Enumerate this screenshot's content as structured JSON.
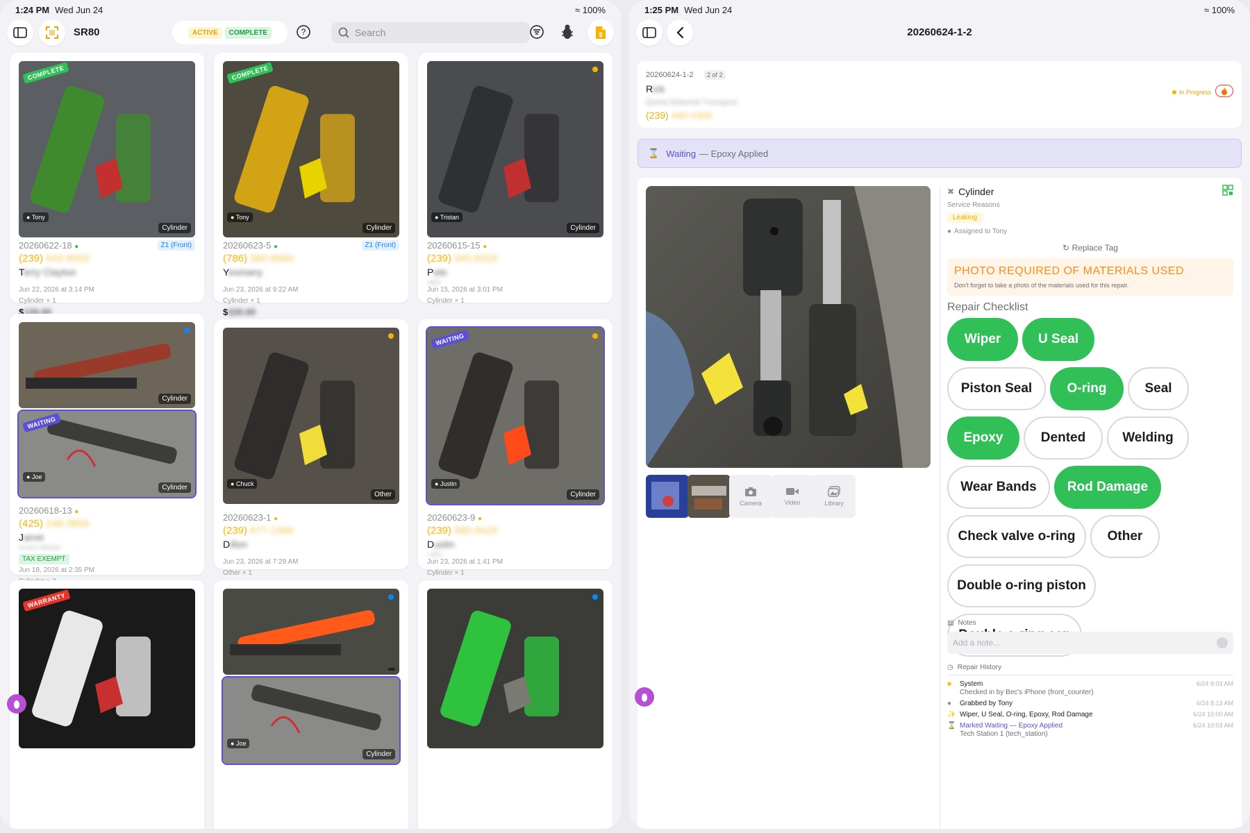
{
  "left": {
    "status": {
      "time": "1:24 PM",
      "date": "Wed Jun 24",
      "battery": "100%"
    },
    "toolbar": {
      "title": "SR80",
      "filter_active": "ACTIVE",
      "filter_complete": "COMPLETE",
      "search_placeholder": "Search"
    },
    "cards": [
      {
        "tag": "COMPLETE",
        "who": "Tony",
        "cat": "Cylinder",
        "id": "20260622-18",
        "zone": "Z1 (Front)",
        "phone": "(239)",
        "phone_rest": "543-8000",
        "name": "T",
        "name_rest": "erry Clayton",
        "date": "Jun 22, 2026 at 3:14 PM",
        "items": "Cylinder × 1",
        "price": "$",
        "price_rest": "120.00"
      },
      {
        "tag": "COMPLETE",
        "who": "Tony",
        "cat": "Cylinder",
        "id": "20260623-5",
        "zone": "Z1 (Front)",
        "phone": "(786)",
        "phone_rest": "380-8984",
        "name": "Y",
        "name_rest": "esmany",
        "date": "Jun 23, 2026 at 9:22 AM",
        "items": "Cylinder × 1",
        "price": "$",
        "price_rest": "220.00"
      },
      {
        "tag": "",
        "who": "Tristan",
        "cat": "Cylinder",
        "id": "20260615-15",
        "zone": "",
        "phone": "(239)",
        "phone_rest": "340-8326",
        "name": "P",
        "name_rest": "ete",
        "sub": "ABS",
        "date": "Jun 15, 2026 at 3:01 PM",
        "items": "Cylinder × 1",
        "price": "",
        "price_rest": ""
      },
      {
        "tag": "WAITING",
        "who": "Joe",
        "cat": "Cylinder",
        "cat_top": "Cylinder",
        "id": "20260618-13",
        "zone": "",
        "phone": "(425)",
        "phone_rest": "248-3856",
        "name": "J",
        "name_rest": "arret",
        "sub": "Evans Mobile",
        "badge": "TAX EXEMPT",
        "date": "Jun 18, 2026 at 2:35 PM",
        "items": "Cylinder × 2",
        "price": "",
        "price_rest": ""
      },
      {
        "tag": "",
        "who": "Chuck",
        "cat": "Other",
        "id": "20260623-1",
        "zone": "",
        "phone": "(239)",
        "phone_rest": "677-1966",
        "name": "D",
        "name_rest": "illon",
        "date": "Jun 23, 2026 at 7:29 AM",
        "items": "Other × 1",
        "price": "",
        "price_rest": ""
      },
      {
        "tag": "WAITING",
        "who": "Justin",
        "cat": "Cylinder",
        "id": "20260623-9",
        "zone": "",
        "phone": "(239)",
        "phone_rest": "980-9426",
        "name": "D",
        "name_rest": "ustin",
        "sub": "LMG",
        "date": "Jun 23, 2026 at 1:41 PM",
        "items": "Cylinder × 1",
        "price": "",
        "price_rest": ""
      },
      {
        "tag": "WARRANTY",
        "who": "",
        "cat": "",
        "id": "",
        "zone": "",
        "phone": "",
        "phone_rest": "",
        "name": "",
        "name_rest": "",
        "date": "",
        "items": "",
        "price": "",
        "price_rest": ""
      },
      {
        "tag": "",
        "who": "Joe",
        "cat": "Cylinder",
        "id": "",
        "zone": "",
        "phone": "",
        "phone_rest": "",
        "name": "",
        "name_rest": "",
        "date": "",
        "items": "",
        "price": "",
        "price_rest": ""
      },
      {
        "tag": "",
        "who": "",
        "cat": "",
        "id": "",
        "zone": "",
        "phone": "",
        "phone_rest": "",
        "name": "",
        "name_rest": "",
        "date": "",
        "items": "",
        "price": "",
        "price_rest": ""
      }
    ]
  },
  "right": {
    "status": {
      "time": "1:25 PM",
      "date": "Wed Jun 24",
      "battery": "100%"
    },
    "title": "20260624-1-2",
    "info": {
      "id": "20260624-1-2",
      "count": "2 of 2",
      "name": "R",
      "name_rest": "ick",
      "company": "Quest Material Transport",
      "phone": "(239)",
      "phone_rest": "440-4300",
      "status": "In Progress"
    },
    "waiting": {
      "label": "Waiting",
      "reason": "— Epoxy Applied"
    },
    "media": {
      "camera": "Camera",
      "video": "Video",
      "library": "Library"
    },
    "part": {
      "name": "Cylinder",
      "service_reasons_label": "Service Reasons",
      "reason": "Leaking",
      "assigned": "Assigned to Tony",
      "replace_tag": "Replace Tag"
    },
    "alert": {
      "title": "PHOTO REQUIRED OF MATERIALS USED",
      "body": "Don't forget to take a photo of the materials used for this repair."
    },
    "checklist_title": "Repair Checklist",
    "checklist": [
      {
        "label": "Wiper",
        "on": true
      },
      {
        "label": "U Seal",
        "on": true
      },
      {
        "label": "Piston Seal",
        "on": false
      },
      {
        "label": "O-ring",
        "on": true
      },
      {
        "label": "Seal",
        "on": false
      },
      {
        "label": "Epoxy",
        "on": true
      },
      {
        "label": "Dented",
        "on": false
      },
      {
        "label": "Welding",
        "on": false
      },
      {
        "label": "Wear Bands",
        "on": false
      },
      {
        "label": "Rod Damage",
        "on": true
      },
      {
        "label": "Check valve o-ring",
        "on": false
      },
      {
        "label": "Other",
        "on": false
      },
      {
        "label": "Double o-ring piston",
        "on": false
      },
      {
        "label": "Double o-ring cap",
        "on": false
      }
    ],
    "notes_label": "Notes",
    "note_placeholder": "Add a note...",
    "history_label": "Repair History",
    "history": [
      {
        "title": "System",
        "detail": "Checked in by Bec's iPhone (front_counter)",
        "time": "6/24 8:03 AM"
      },
      {
        "title": "Grabbed by Tony",
        "detail": "",
        "time": "6/24 8:13 AM"
      },
      {
        "title": "Wiper, U Seal, O-ring, Epoxy, Rod Damage",
        "detail": "",
        "time": "6/24 10:00 AM"
      },
      {
        "title": "Marked Waiting — Epoxy Applied",
        "detail": "Tech Station 1 (tech_station)",
        "time": "6/24 10:03 AM"
      }
    ]
  },
  "colors": {
    "green": "#30c057",
    "yellow": "#e8b100",
    "waiting": "#5b4fd6",
    "warranty": "#e5342b",
    "blue": "#0a84ff",
    "orange": "#ff9500"
  }
}
